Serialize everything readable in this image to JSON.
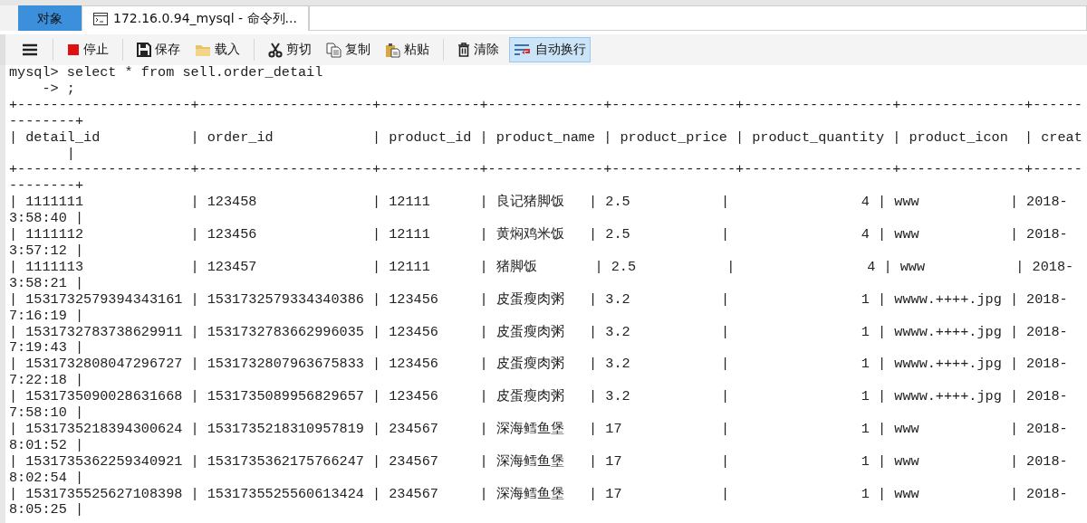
{
  "tabs": [
    {
      "label": "对象",
      "selected": false,
      "kind": "plain"
    },
    {
      "label": "172.16.0.94_mysql - 命令列...",
      "selected": true,
      "kind": "console"
    }
  ],
  "toolbar": {
    "groups": [
      [
        {
          "kind": "stop",
          "label": "停止",
          "on": false
        }
      ],
      [
        {
          "kind": "save",
          "label": "保存",
          "on": false
        },
        {
          "kind": "load",
          "label": "载入",
          "on": false
        }
      ],
      [
        {
          "kind": "cut",
          "label": "剪切",
          "on": false
        },
        {
          "kind": "copy",
          "label": "复制",
          "on": false
        },
        {
          "kind": "paste",
          "label": "粘贴",
          "on": false
        }
      ],
      [
        {
          "kind": "clear",
          "label": "清除",
          "on": false
        },
        {
          "kind": "wrap",
          "label": "自动换行",
          "on": true
        }
      ]
    ]
  },
  "console": {
    "lines": [
      "mysql> select * from sell.order_detail",
      "    -> ;",
      "+---------------------+---------------------+------------+--------------+---------------+------------------+---------------+------",
      "--------+",
      "| detail_id           | order_id            | product_id | product_name | product_price | product_quantity | product_icon  | creat",
      "       |",
      "+---------------------+---------------------+------------+--------------+---------------+------------------+---------------+------",
      "--------+",
      "| 1111111             | 123458              | 12111      | 良记猪脚饭   | 2.5           |                4 | www           | 2018-",
      "3:58:40 |",
      "| 1111112             | 123456              | 12111      | 黄焖鸡米饭   | 2.5           |                4 | www           | 2018-",
      "3:57:12 |",
      "| 1111113             | 123457              | 12111      | 猪脚饭       | 2.5           |                4 | www           | 2018-",
      "3:58:21 |",
      "| 1531732579394343161 | 1531732579334340386 | 123456     | 皮蛋瘦肉粥   | 3.2           |                1 | wwww.++++.jpg | 2018-",
      "7:16:19 |",
      "| 1531732783738629911 | 1531732783662996035 | 123456     | 皮蛋瘦肉粥   | 3.2           |                1 | wwww.++++.jpg | 2018-",
      "7:19:43 |",
      "| 1531732808047296727 | 1531732807963675833 | 123456     | 皮蛋瘦肉粥   | 3.2           |                1 | wwww.++++.jpg | 2018-",
      "7:22:18 |",
      "| 1531735090028631668 | 1531735089956829657 | 123456     | 皮蛋瘦肉粥   | 3.2           |                1 | wwww.++++.jpg | 2018-",
      "7:58:10 |",
      "| 1531735218394300624 | 1531735218310957819 | 234567     | 深海鳕鱼堡   | 17            |                1 | www           | 2018-",
      "8:01:52 |",
      "| 1531735362259340921 | 1531735362175766247 | 234567     | 深海鳕鱼堡   | 17            |                1 | www           | 2018-",
      "8:02:54 |",
      "| 1531735525627108398 | 1531735525560613424 | 234567     | 深海鳕鱼堡   | 17            |                1 | www           | 2018-",
      "8:05:25 |"
    ]
  }
}
